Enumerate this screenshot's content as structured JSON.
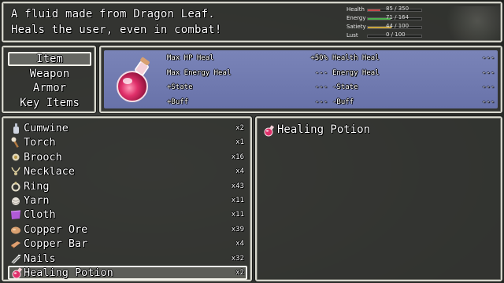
{
  "help": {
    "line1": "A fluid made from Dragon Leaf.",
    "line2": "Heals the user, even in combat!"
  },
  "stats": [
    {
      "label": "Health",
      "value": "85 / 350",
      "fill": 0.24,
      "color": "#c44a4a"
    },
    {
      "label": "Energy",
      "value": "71 / 164",
      "fill": 0.43,
      "color": "#4bb04b"
    },
    {
      "label": "Satiety",
      "value": "44 / 100",
      "fill": 0.44,
      "color": "#c9a43a"
    },
    {
      "label": "Lust",
      "value": "0 / 100",
      "fill": 0.0,
      "color": "#c85bb0"
    }
  ],
  "categories": [
    "Item",
    "Weapon",
    "Armor",
    "Key Items"
  ],
  "selected_category": 0,
  "info": {
    "left": [
      {
        "key": "Max HP Heal",
        "value": "+50%"
      },
      {
        "key": "Max Energy Heal",
        "value": "---"
      },
      {
        "key": "+State",
        "value": "---"
      },
      {
        "key": "+Buff",
        "value": "---"
      }
    ],
    "right": [
      {
        "key": "Health Heal",
        "value": "---"
      },
      {
        "key": "Energy Heal",
        "value": "---"
      },
      {
        "key": "-State",
        "value": "---"
      },
      {
        "key": "-Buff",
        "value": "---"
      }
    ]
  },
  "items": [
    {
      "name": "Cumwine",
      "qty": "x2",
      "icon": "bottle-icon"
    },
    {
      "name": "Torch",
      "qty": "x1",
      "icon": "torch-icon"
    },
    {
      "name": "Brooch",
      "qty": "x16",
      "icon": "brooch-icon"
    },
    {
      "name": "Necklace",
      "qty": "x4",
      "icon": "necklace-icon"
    },
    {
      "name": "Ring",
      "qty": "x43",
      "icon": "ring-icon"
    },
    {
      "name": "Yarn",
      "qty": "x11",
      "icon": "yarn-icon"
    },
    {
      "name": "Cloth",
      "qty": "x11",
      "icon": "cloth-icon"
    },
    {
      "name": "Copper Ore",
      "qty": "x39",
      "icon": "ore-icon"
    },
    {
      "name": "Copper Bar",
      "qty": "x4",
      "icon": "bar-icon"
    },
    {
      "name": "Nails",
      "qty": "x32",
      "icon": "nails-icon"
    },
    {
      "name": "Healing Potion",
      "qty": "x2",
      "icon": "potion-icon"
    }
  ],
  "selected_item": 10,
  "detail": {
    "name": "Healing Potion",
    "icon": "potion-icon"
  },
  "colors": {
    "panel": "#6872a9",
    "window": "#343632",
    "border": "#d6d6cc",
    "potion": "#e0306a"
  }
}
